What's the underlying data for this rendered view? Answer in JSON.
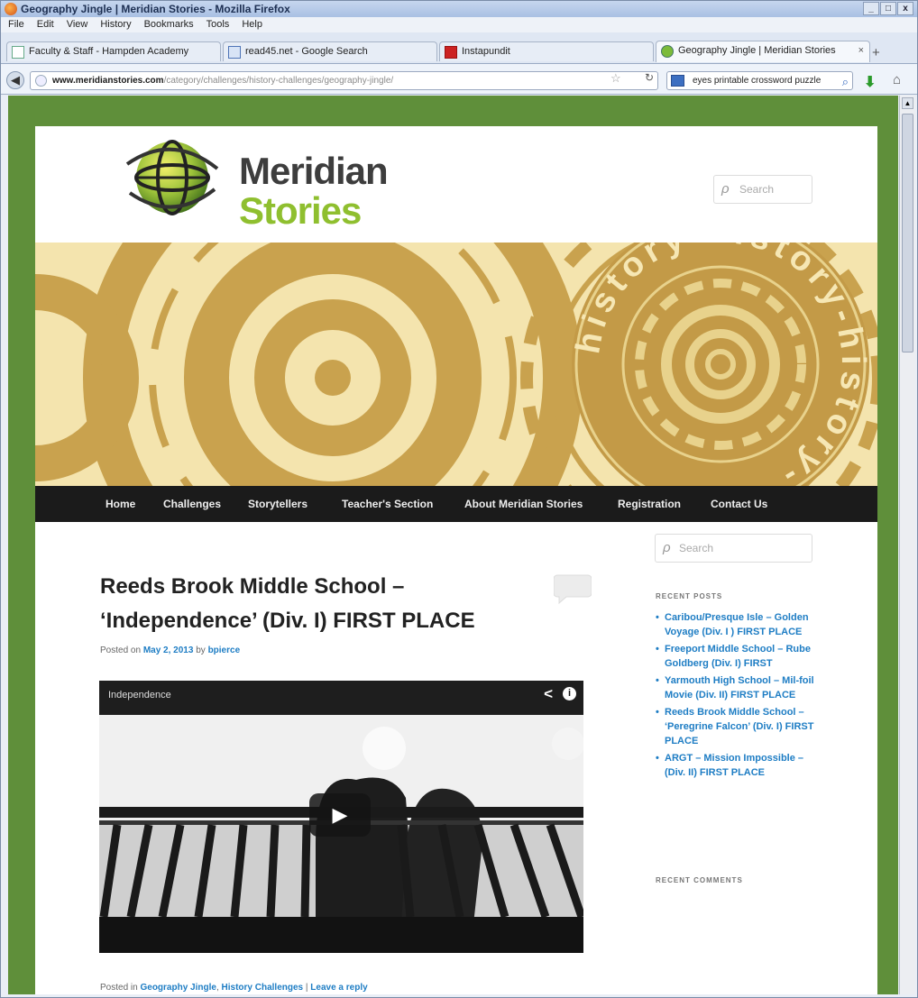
{
  "window": {
    "title": "Geography Jingle | Meridian Stories - Mozilla Firefox",
    "controls": [
      "_",
      "□",
      "x"
    ]
  },
  "menubar": [
    "File",
    "Edit",
    "View",
    "History",
    "Bookmarks",
    "Tools",
    "Help"
  ],
  "tabs": [
    {
      "label": "Faculty & Staff - Hampden Academy"
    },
    {
      "label": "read45.net - Google Search"
    },
    {
      "label": "Instapundit"
    },
    {
      "label": "Geography Jingle | Meridian Stories",
      "active": true
    }
  ],
  "navbar": {
    "url_domain": "www.meridianstories.com",
    "url_path": "/category/challenges/history-challenges/geography-jingle/",
    "search_text": "eyes printable crossword puzzle"
  },
  "site": {
    "logo_line1": "Meridian",
    "logo_line2": "Stories",
    "search_placeholder": "Search",
    "banner_text": "history-history-history-",
    "colors": {
      "page_bg": "#5f8f3a",
      "banner_bg": "#f4e4ae",
      "banner_ring": "#c9a24e",
      "nav_bg": "#1b1b1b",
      "link": "#1e7dc4",
      "logo_green": "#8fbf2f"
    }
  },
  "nav": [
    "Home",
    "Challenges",
    "Storytellers",
    "Teacher's Section",
    "About Meridian Stories",
    "Registration",
    "Contact Us"
  ],
  "post": {
    "title_line1": "Reeds Brook Middle School –",
    "title_line2": "‘Independence’ (Div. I) FIRST PLACE",
    "posted_on": "Posted on",
    "date": "May 2, 2013",
    "by": "by",
    "author": "bpierce",
    "video_title": "Independence",
    "footer_prefix": "Posted in",
    "category1": "Geography Jingle",
    "category2": "History Challenges",
    "separator": "|",
    "leave_reply": "Leave a reply"
  },
  "sidebar": {
    "search_placeholder": "Search",
    "recent_posts_title": "RECENT POSTS",
    "recent_posts": [
      "Caribou/Presque Isle – Golden Voyage (Div. I ) FIRST PLACE",
      "Freeport Middle School – Rube Goldberg (Div. I) FIRST",
      "Yarmouth High School – Mil-foil Movie (Div. II) FIRST PLACE",
      "Reeds Brook Middle School – ‘Peregrine Falcon’ (Div. I) FIRST PLACE",
      "ARGT – Mission Impossible – (Div. II) FIRST PLACE"
    ],
    "recent_comments_title": "RECENT COMMENTS"
  }
}
